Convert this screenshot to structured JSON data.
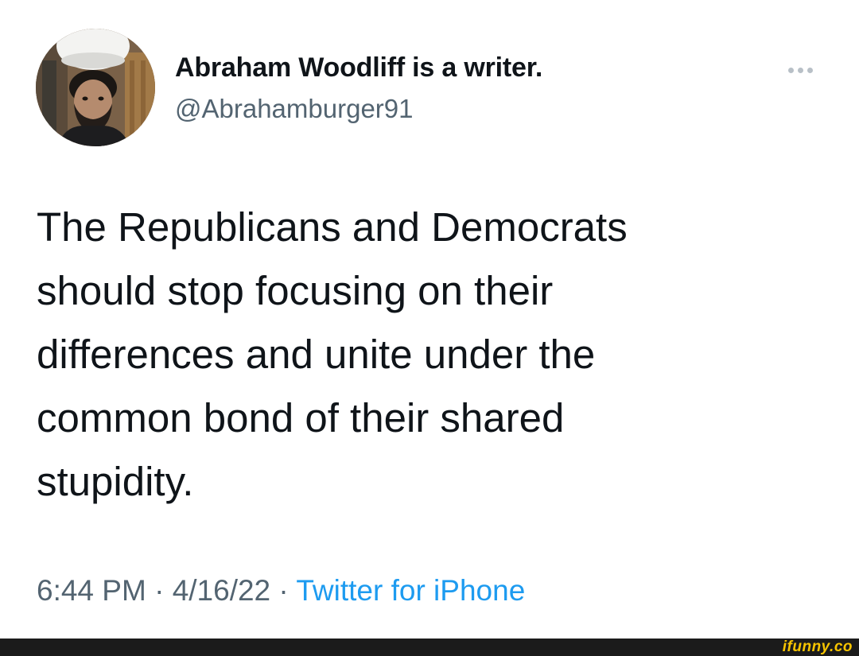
{
  "tweet": {
    "display_name": "Abraham Woodliff is a writer.",
    "handle": "@Abrahamburger91",
    "text_lines": [
      "The Republicans and Democrats",
      "should stop focusing on their",
      "differences and unite under the",
      "common bond of their shared",
      "stupidity."
    ],
    "time": "6:44 PM",
    "separator": "·",
    "date": "4/16/22",
    "source": "Twitter for iPhone",
    "more_icon": "ellipsis-icon"
  },
  "footer": {
    "watermark": "ifunny.co"
  },
  "colors": {
    "text": "#0f1419",
    "secondary": "#536471",
    "link": "#1d9bf0",
    "watermark": "#f7c400",
    "bar": "#1b1b1b"
  }
}
